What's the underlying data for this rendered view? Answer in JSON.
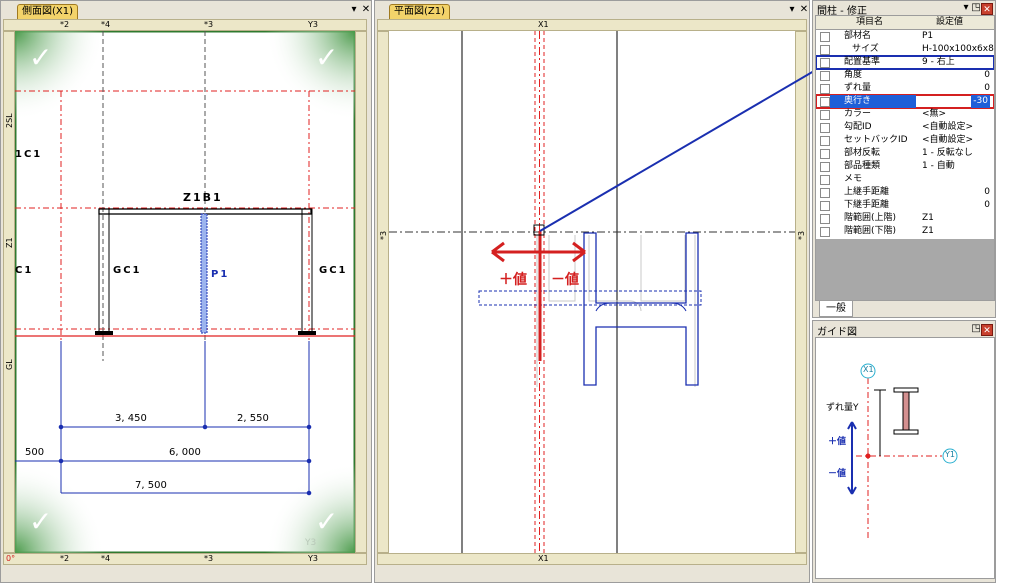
{
  "side_view": {
    "tab": "側面図(X1)",
    "ruler_top": [
      "*2",
      "*4",
      "*3",
      "Y3"
    ],
    "ruler_bottom": [
      "0°",
      "*2",
      "*4",
      "*3",
      "Y3"
    ],
    "ruler_left": [
      "2SL",
      "Z1",
      "GL"
    ],
    "labels": {
      "beam": "Z1B1",
      "col_left_partial": "1C1",
      "col_left_edge": "C1",
      "col_left": "GC1",
      "col_mid": "P1",
      "col_right": "GC1",
      "dim_1": "3, 450",
      "dim_2": "2, 550",
      "dim_3": "6, 000",
      "dim_4": "7, 500",
      "dim_left": "500",
      "watermark": "Y3"
    }
  },
  "plan_view": {
    "tab": "平面図(Z1)",
    "ruler_top": [
      "X1"
    ],
    "ruler_bottom": [
      "X1"
    ],
    "ruler_left": [
      "*3"
    ],
    "ruler_right": [
      "*3"
    ],
    "plus_label": "＋値",
    "minus_label": "－値"
  },
  "properties": {
    "title": "間柱 - 修正",
    "col_name": "項目名",
    "col_value": "設定値",
    "rows": [
      {
        "name": "部材名",
        "value": "P1"
      },
      {
        "name": "サイズ",
        "value": "H-100x100x6x8"
      },
      {
        "name": "配置基準",
        "value": "9 - 右上"
      },
      {
        "name": "角度",
        "value": "0"
      },
      {
        "name": "ずれ量",
        "value": "0"
      },
      {
        "name": "奥行き",
        "value": "-30"
      },
      {
        "name": "カラー",
        "value": "<無>"
      },
      {
        "name": "勾配ID",
        "value": "<自動設定>"
      },
      {
        "name": "セットバックID",
        "value": "<自動設定>"
      },
      {
        "name": "部材反転",
        "value": "1 - 反転なし"
      },
      {
        "name": "部品種類",
        "value": "1 - 自動"
      },
      {
        "name": "メモ",
        "value": ""
      },
      {
        "name": "上継手距離",
        "value": "0"
      },
      {
        "name": "下継手距離",
        "value": "0"
      },
      {
        "name": "階範囲(上階)",
        "value": "Z1"
      },
      {
        "name": "階範囲(下階)",
        "value": "Z1"
      }
    ],
    "tab_general": "一般"
  },
  "guide": {
    "title": "ガイド図",
    "x_label": "X1",
    "y_label": "Y1",
    "offset_label": "ずれ量Y",
    "plus": "＋値",
    "minus": "－値"
  },
  "colors": {
    "accent_blue": "#1a2fb0",
    "accent_red": "#d42020",
    "grid_red": "#e02020",
    "tab_yellow": "#f3d36a"
  }
}
